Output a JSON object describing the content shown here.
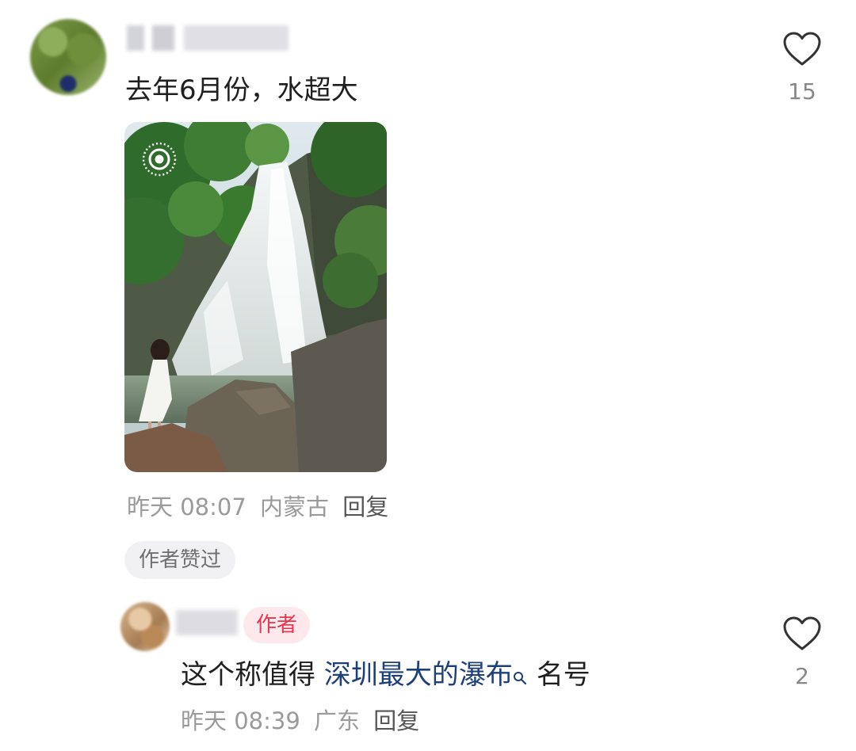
{
  "comment": {
    "text": "去年6月份，水超大",
    "time": "昨天 08:07",
    "location": "内蒙古",
    "reply_label": "回复",
    "liked_by_author_label": "作者赞过",
    "like_count": "15"
  },
  "reply": {
    "author_badge": "作者",
    "text_before": "这个称值得 ",
    "link_text": "深圳最大的瀑布",
    "text_after": "名号",
    "time": "昨天 08:39",
    "location": "广东",
    "reply_label": "回复",
    "like_count": "2"
  },
  "icons": {
    "like": "heart-outline-icon",
    "live_photo": "live-photo-icon",
    "search": "search-icon"
  },
  "colors": {
    "author_badge_text": "#e4364f",
    "author_badge_bg": "#fde8ec",
    "link_text": "#1d3f7a",
    "meta_text": "#9a9a9a"
  }
}
